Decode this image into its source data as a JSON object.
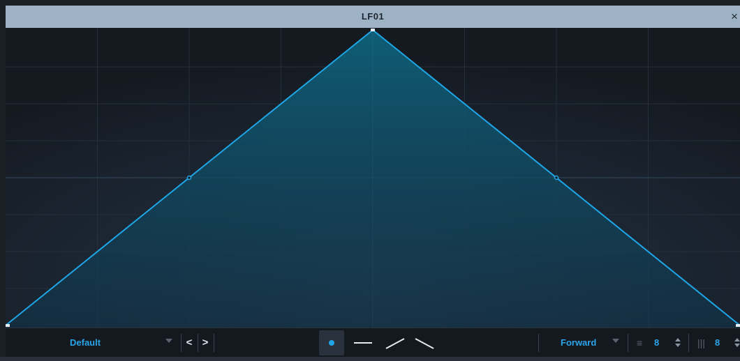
{
  "window": {
    "title": "LF01",
    "close_glyph": "×"
  },
  "envelope": {
    "shape": "triangle",
    "points": [
      {
        "t": 0.0,
        "v": 0.0
      },
      {
        "t": 0.5,
        "v": 1.0
      },
      {
        "t": 1.0,
        "v": 0.0
      }
    ],
    "curve_handles": [
      {
        "t": 0.25,
        "v": 0.5
      },
      {
        "t": 0.75,
        "v": 0.5
      }
    ],
    "line_color": "#1ea6e6"
  },
  "toolbar": {
    "preset": "Default",
    "prev_glyph": "<",
    "next_glyph": ">",
    "modes": [
      "point-mode-icon",
      "flat-line-icon",
      "ramp-up-icon",
      "ramp-down-icon"
    ],
    "active_mode": 0,
    "direction": "Forward",
    "steps_value": "8",
    "grid_value": "8",
    "accent": "#2aa5e8"
  }
}
